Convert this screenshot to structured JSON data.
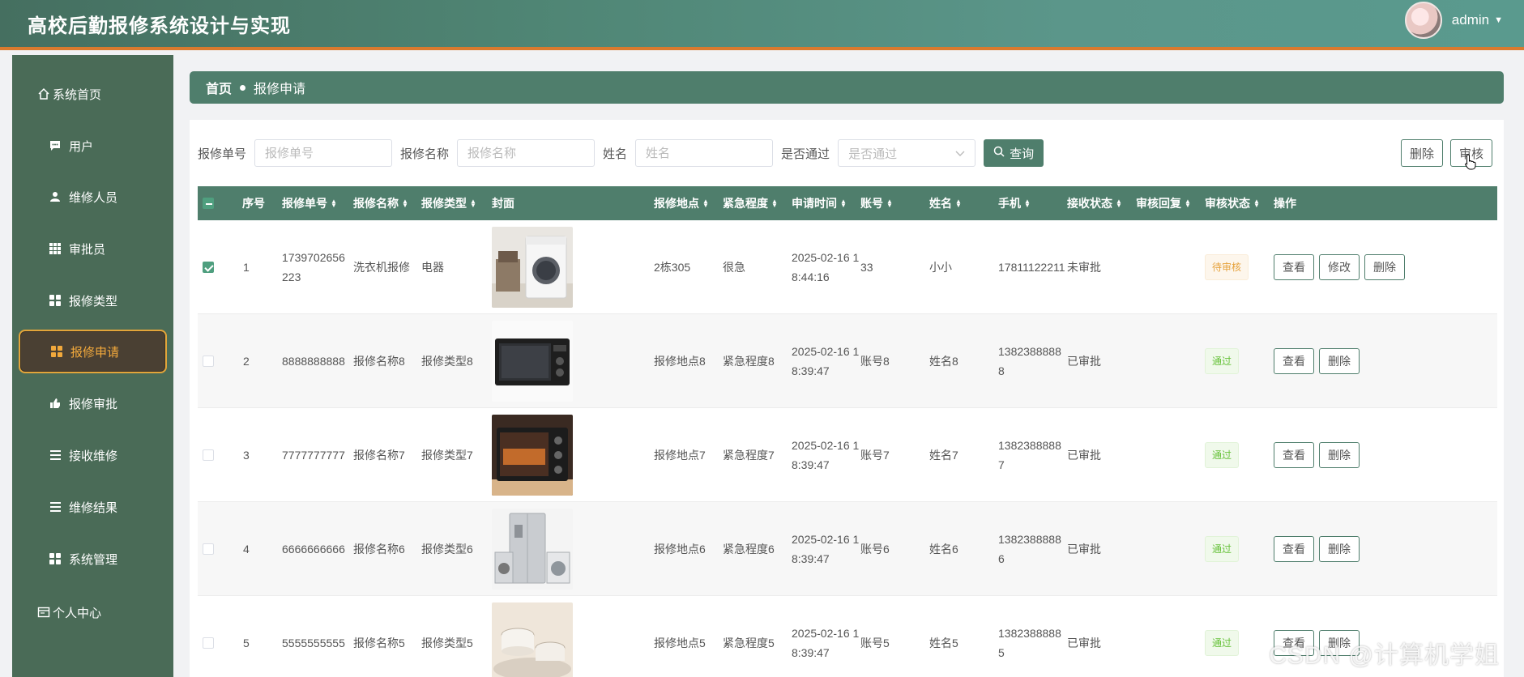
{
  "header": {
    "title": "高校后勤报修系统设计与实现",
    "user": "admin",
    "caret": "▼"
  },
  "sidebar": {
    "items": [
      {
        "label": "系统首页",
        "icon": "home-icon"
      },
      {
        "label": "用户",
        "icon": "chat-icon"
      },
      {
        "label": "维修人员",
        "icon": "person-icon"
      },
      {
        "label": "审批员",
        "icon": "grid9-icon"
      },
      {
        "label": "报修类型",
        "icon": "grid-icon"
      },
      {
        "label": "报修申请",
        "icon": "grid-icon",
        "active": true
      },
      {
        "label": "报修审批",
        "icon": "thumb-icon"
      },
      {
        "label": "接收维修",
        "icon": "list-icon"
      },
      {
        "label": "维修结果",
        "icon": "list-icon"
      },
      {
        "label": "系统管理",
        "icon": "grid-icon"
      },
      {
        "label": "个人中心",
        "icon": "calendar-icon"
      }
    ]
  },
  "breadcrumb": {
    "home": "首页",
    "current": "报修申请"
  },
  "search": {
    "order_label": "报修单号",
    "order_placeholder": "报修单号",
    "name_label": "报修名称",
    "name_placeholder": "报修名称",
    "person_label": "姓名",
    "person_placeholder": "姓名",
    "pass_label": "是否通过",
    "pass_placeholder": "是否通过",
    "search_button": "查询"
  },
  "toolbar": {
    "delete": "删除",
    "review": "审核"
  },
  "table": {
    "headers": [
      "序号",
      "报修单号",
      "报修名称",
      "报修类型",
      "封面",
      "报修地点",
      "紧急程度",
      "申请时间",
      "账号",
      "姓名",
      "手机",
      "接收状态",
      "审核回复",
      "审核状态",
      "操作"
    ],
    "rows": [
      {
        "no": "1",
        "order": "1739702656223",
        "name": "洗衣机报修",
        "type": "电器",
        "place": "2栋305",
        "urgency": "很急",
        "time": "2025-02-16 18:44:16",
        "account": "33",
        "person": "小小",
        "phone": "17811122211",
        "receive": "未审批",
        "reply": "",
        "status": "待审核",
        "checked": true,
        "ops": [
          "查看",
          "修改",
          "删除"
        ]
      },
      {
        "no": "2",
        "order": "8888888888",
        "name": "报修名称8",
        "type": "报修类型8",
        "place": "报修地点8",
        "urgency": "紧急程度8",
        "time": "2025-02-16 18:39:47",
        "account": "账号8",
        "person": "姓名8",
        "phone": "13823888888",
        "receive": "已审批",
        "reply": "",
        "status": "通过",
        "checked": false,
        "ops": [
          "查看",
          "删除"
        ]
      },
      {
        "no": "3",
        "order": "7777777777",
        "name": "报修名称7",
        "type": "报修类型7",
        "place": "报修地点7",
        "urgency": "紧急程度7",
        "time": "2025-02-16 18:39:47",
        "account": "账号7",
        "person": "姓名7",
        "phone": "13823888887",
        "receive": "已审批",
        "reply": "",
        "status": "通过",
        "checked": false,
        "ops": [
          "查看",
          "删除"
        ]
      },
      {
        "no": "4",
        "order": "6666666666",
        "name": "报修名称6",
        "type": "报修类型6",
        "place": "报修地点6",
        "urgency": "紧急程度6",
        "time": "2025-02-16 18:39:47",
        "account": "账号6",
        "person": "姓名6",
        "phone": "13823888886",
        "receive": "已审批",
        "reply": "",
        "status": "通过",
        "checked": false,
        "ops": [
          "查看",
          "删除"
        ]
      },
      {
        "no": "5",
        "order": "5555555555",
        "name": "报修名称5",
        "type": "报修类型5",
        "place": "报修地点5",
        "urgency": "紧急程度5",
        "time": "2025-02-16 18:39:47",
        "account": "账号5",
        "person": "姓名5",
        "phone": "13823888885",
        "receive": "已审批",
        "reply": "",
        "status": "通过",
        "checked": false,
        "ops": [
          "查看",
          "删除"
        ]
      }
    ]
  },
  "watermark": "CSDN @计算机学姐",
  "colors": {
    "primary": "#4f7e6c",
    "sidebar": "#4a6b57",
    "accent": "#e2a53a",
    "pending": "#e6a23c",
    "pass": "#67c23a"
  }
}
